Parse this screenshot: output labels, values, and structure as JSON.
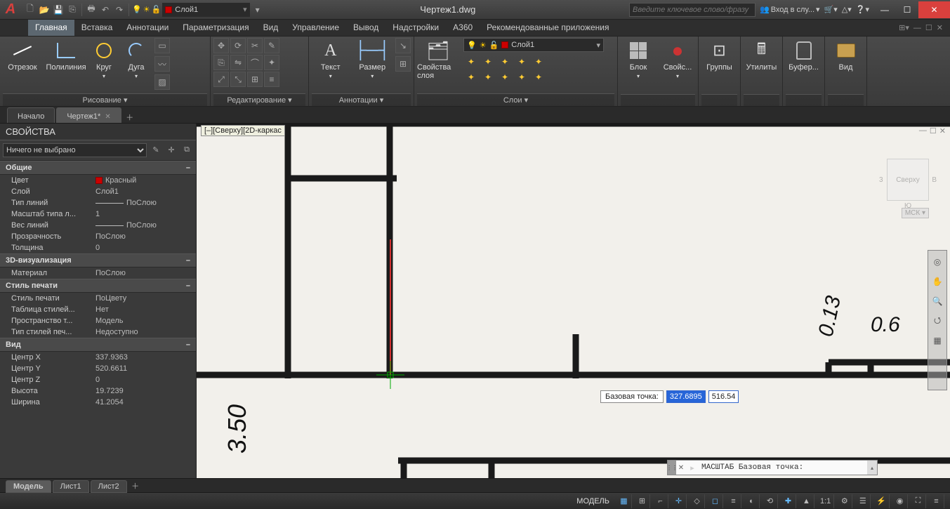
{
  "title": "Чертеж1.dwg",
  "search_placeholder": "Введите ключевое слово/фразу",
  "signin": "Вход в слу...",
  "app_logo": "A",
  "win": {
    "min": "—",
    "max": "☐",
    "close": "✕"
  },
  "qat_layer": "Слой1",
  "ribbon_tabs": [
    "Главная",
    "Вставка",
    "Аннотации",
    "Параметризация",
    "Вид",
    "Управление",
    "Вывод",
    "Надстройки",
    "A360",
    "Рекомендованные приложения"
  ],
  "ribbon_active": 0,
  "panels": {
    "draw": {
      "label": "Рисование ▾",
      "items": [
        "Отрезок",
        "Полилиния",
        "Круг",
        "Дуга"
      ]
    },
    "edit": {
      "label": "Редактирование ▾"
    },
    "anno": {
      "label": "Аннотации ▾",
      "text": "Текст",
      "dim": "Размер"
    },
    "layers": {
      "label": "Слои ▾",
      "current": "Слой1",
      "props": "Свойства слоя"
    },
    "block": {
      "label": "",
      "block": "Блок",
      "props": "Свойс..."
    },
    "groups": "Группы",
    "util": "Утилиты",
    "buffer": "Буфер...",
    "view": "Вид"
  },
  "filetabs": [
    {
      "label": "Начало",
      "active": false
    },
    {
      "label": "Чертеж1*",
      "active": true
    }
  ],
  "props": {
    "title": "СВОЙСТВА",
    "selector": "Ничего не выбрано",
    "sections": [
      {
        "title": "Общие",
        "rows": [
          {
            "k": "Цвет",
            "v": "Красный",
            "color": true
          },
          {
            "k": "Слой",
            "v": "Слой1"
          },
          {
            "k": "Тип линий",
            "v": "ПоСлою",
            "line": true
          },
          {
            "k": "Масштаб типа л...",
            "v": "1"
          },
          {
            "k": "Вес линий",
            "v": "ПоСлою",
            "line": true
          },
          {
            "k": "Прозрачность",
            "v": "ПоСлою"
          },
          {
            "k": "Толщина",
            "v": "0"
          }
        ]
      },
      {
        "title": "3D-визуализация",
        "rows": [
          {
            "k": "Материал",
            "v": "ПоСлою"
          }
        ]
      },
      {
        "title": "Стиль печати",
        "rows": [
          {
            "k": "Стиль печати",
            "v": "ПоЦвету"
          },
          {
            "k": "Таблица  стилей...",
            "v": "Нет"
          },
          {
            "k": "Пространство т...",
            "v": "Модель"
          },
          {
            "k": "Тип стилей печ...",
            "v": "Недоступно"
          }
        ]
      },
      {
        "title": "Вид",
        "rows": [
          {
            "k": "Центр X",
            "v": "337.9363"
          },
          {
            "k": "Центр Y",
            "v": "520.6611"
          },
          {
            "k": "Центр Z",
            "v": "0"
          },
          {
            "k": "Высота",
            "v": "19.7239"
          },
          {
            "k": "Ширина",
            "v": "41.2054"
          }
        ]
      }
    ]
  },
  "viewport_label": "[–][Сверху][2D-каркас",
  "viewcube": "Сверху",
  "viewcube_nums": {
    "left": "3",
    "right": "B",
    "bottom": "Ю"
  },
  "wcs": "МСК ▾",
  "coord": {
    "label": "Базовая точка:",
    "x": "327.6895",
    "y": "516.54"
  },
  "cmdline": "МАСШТАБ Базовая точка:",
  "drawing_text": {
    "left": "3.50",
    "r1": "0.13",
    "r2": "0.6"
  },
  "layout_tabs": [
    "Модель",
    "Лист1",
    "Лист2"
  ],
  "layout_active": 0,
  "status": {
    "model": "МОДЕЛЬ",
    "scale": "1:1"
  }
}
